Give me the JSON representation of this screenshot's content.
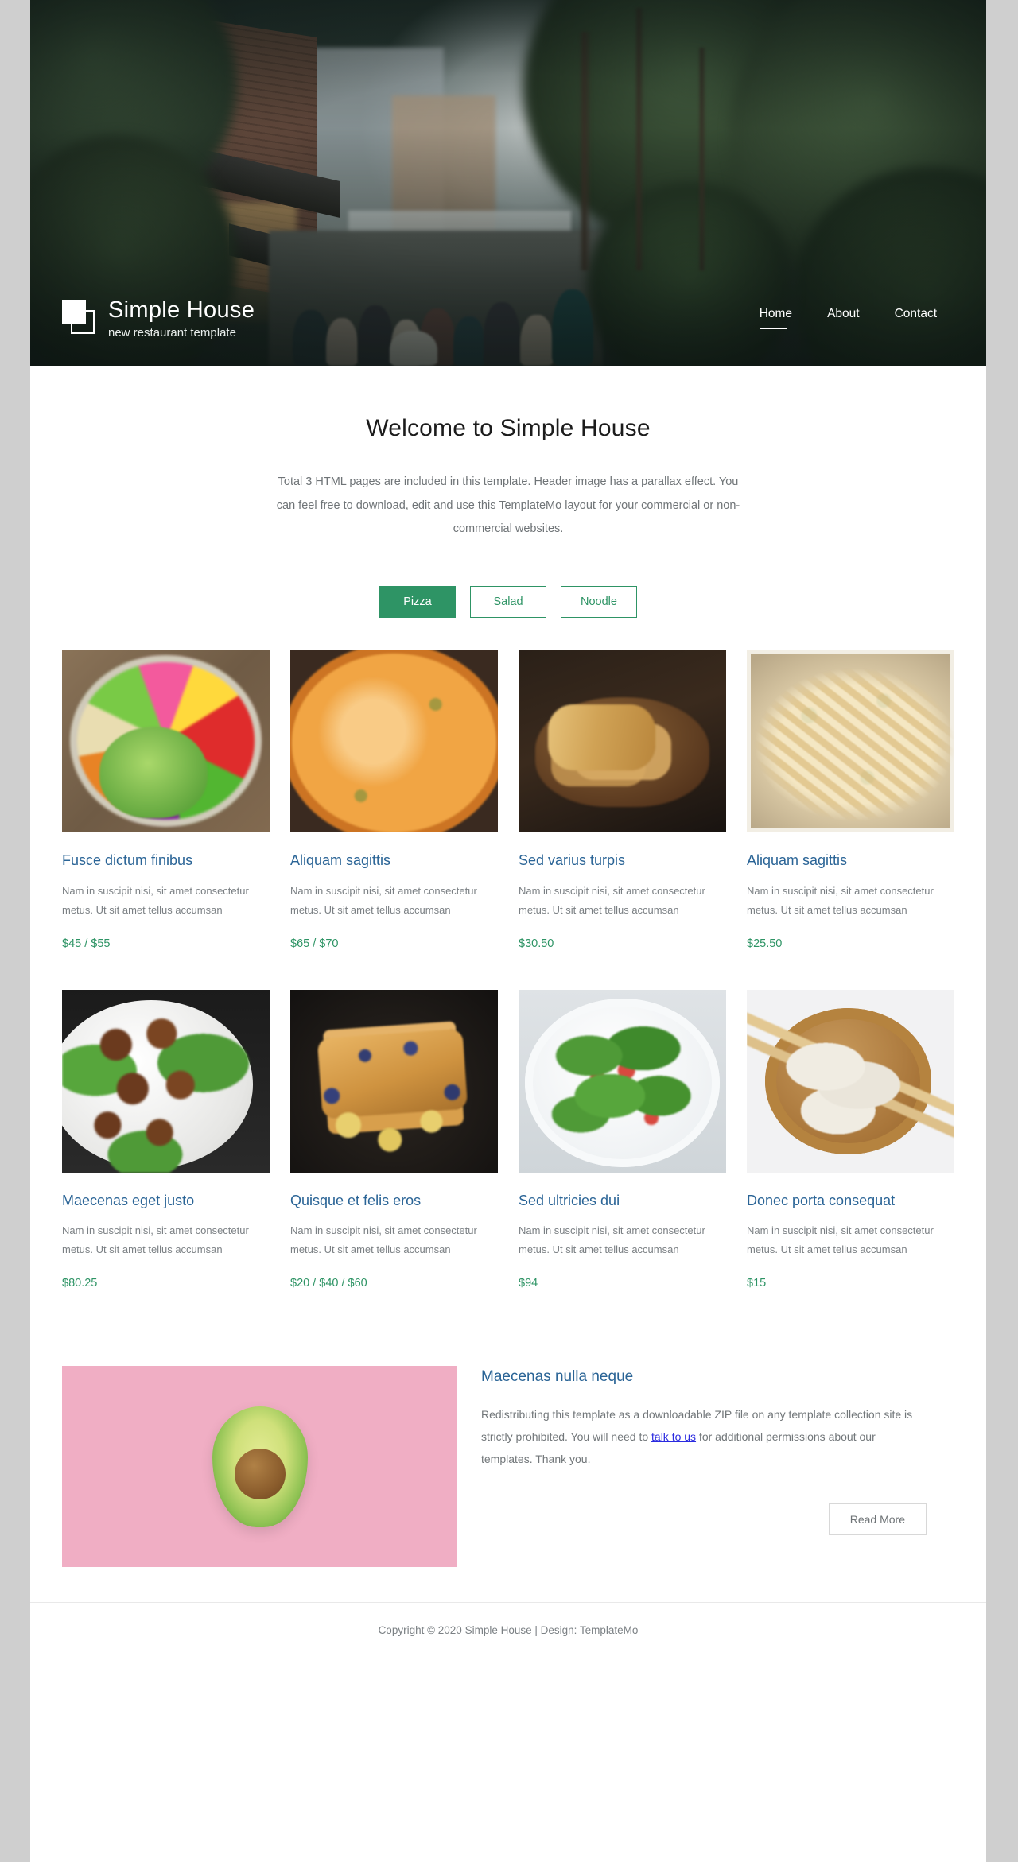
{
  "brand": {
    "title": "Simple House",
    "subtitle": "new restaurant template",
    "logo_icon": "two-squares-logo-icon"
  },
  "nav": {
    "items": [
      {
        "label": "Home",
        "active": true
      },
      {
        "label": "About",
        "active": false
      },
      {
        "label": "Contact",
        "active": false
      }
    ]
  },
  "welcome": {
    "heading": "Welcome to Simple House",
    "paragraph": "Total 3 HTML pages are included in this template. Header image has a parallax effect. You can feel free to download, edit and use this TemplateMo layout for your commercial or non-commercial websites."
  },
  "filters": {
    "buttons": [
      {
        "label": "Pizza",
        "active": true
      },
      {
        "label": "Salad",
        "active": false
      },
      {
        "label": "Noodle",
        "active": false
      }
    ]
  },
  "menu": {
    "description": "Nam in suscipit nisi, sit amet consectetur metus. Ut sit amet tellus accumsan",
    "items": [
      {
        "title": "Fusce dictum finibus",
        "desc": "Nam in suscipit nisi, sit amet consectetur metus. Ut sit amet tellus accumsan",
        "price": "$45 / $55",
        "image": "buddha-bowl-salad-photo"
      },
      {
        "title": "Aliquam sagittis",
        "desc": "Nam in suscipit nisi, sit amet consectetur metus. Ut sit amet tellus accumsan",
        "price": "$65 / $70",
        "image": "pepperoni-pizza-photo"
      },
      {
        "title": "Sed varius turpis",
        "desc": "Nam in suscipit nisi, sit amet consectetur metus. Ut sit amet tellus accumsan",
        "price": "$30.50",
        "image": "grilled-chicken-photo"
      },
      {
        "title": "Aliquam sagittis",
        "desc": "Nam in suscipit nisi, sit amet consectetur metus. Ut sit amet tellus accumsan",
        "price": "$25.50",
        "image": "fettuccine-pasta-photo"
      },
      {
        "title": "Maecenas eget justo",
        "desc": "Nam in suscipit nisi, sit amet consectetur metus. Ut sit amet tellus accumsan",
        "price": "$80.25",
        "image": "meatballs-greens-photo"
      },
      {
        "title": "Quisque et felis eros",
        "desc": "Nam in suscipit nisi, sit amet consectetur metus. Ut sit amet tellus accumsan",
        "price": "$20 / $40 / $60",
        "image": "french-toast-banana-photo"
      },
      {
        "title": "Sed ultricies dui",
        "desc": "Nam in suscipit nisi, sit amet consectetur metus. Ut sit amet tellus accumsan",
        "price": "$94",
        "image": "green-salad-bowl-photo"
      },
      {
        "title": "Donec porta consequat",
        "desc": "Nam in suscipit nisi, sit amet consectetur metus. Ut sit amet tellus accumsan",
        "price": "$15",
        "image": "dumplings-chopsticks-photo"
      }
    ]
  },
  "feature": {
    "image": "avocado-on-pink-photo",
    "heading": "Maecenas nulla neque",
    "text_before_link": "Redistributing this template as a downloadable ZIP file on any template collection site is strictly prohibited. You will need to ",
    "link_label": "talk to us",
    "text_after_link": " for additional permissions about our templates. Thank you.",
    "button_label": "Read More"
  },
  "footer": {
    "copyright": "Copyright © 2020 Simple House | Design: TemplateMo"
  },
  "colors": {
    "accent_green": "#2e9465",
    "title_blue": "#2a6496",
    "link_blue": "#2a2ae0",
    "body_grey": "#7b8084",
    "page_gutter": "#cfcfcf"
  }
}
